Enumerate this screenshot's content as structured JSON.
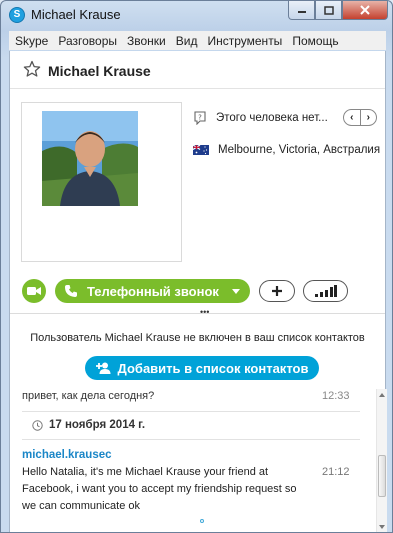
{
  "window": {
    "title": "Michael Krause",
    "app_icon": "skype-icon",
    "controls": [
      "minimize-icon",
      "maximize-icon",
      "close-icon"
    ]
  },
  "menu": [
    {
      "label": "Skype"
    },
    {
      "label": "Разговоры"
    },
    {
      "label": "Звонки"
    },
    {
      "label": "Вид"
    },
    {
      "label": "Инструменты"
    },
    {
      "label": "Помощь"
    }
  ],
  "contact": {
    "name": "Michael Krause",
    "mood": "Этого человека нет...",
    "location": "Melbourne, Victoria, Австралия",
    "flag": "australia-flag-icon"
  },
  "actions": {
    "call_label": "Телефонный звонок",
    "accent_color": "#7bbd2b",
    "add_accent": "#00a2d8"
  },
  "notice": {
    "text": "Пользователь Michael Krause не включен в ваш список контактов",
    "add_label": "Добавить в список контактов"
  },
  "chat": {
    "prev_message": "привет, как дела сегодня?",
    "prev_time": "12:33",
    "date": "17 ноября 2014 г.",
    "sender": "michael.krausec",
    "message": "Hello Natalia, it's me Michael Krause your friend at Facebook, i want you to accept my friendship request so we can communicate ok",
    "time": "21:12"
  }
}
